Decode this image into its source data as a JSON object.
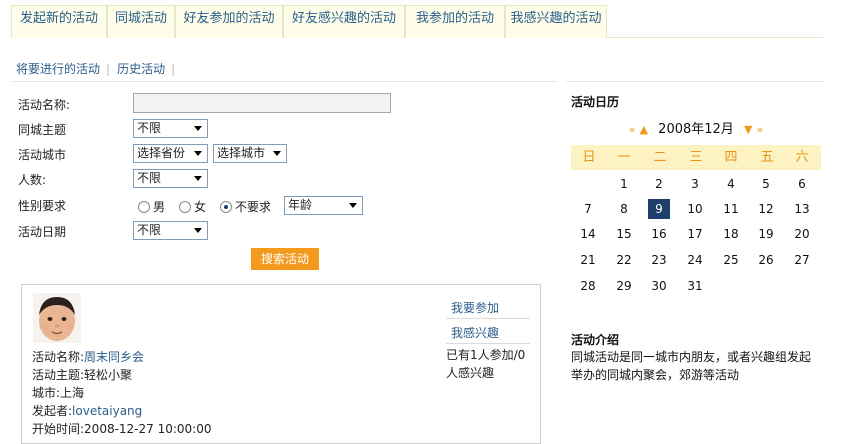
{
  "tabs": [
    {
      "label": "发起新的活动"
    },
    {
      "label": "同城活动"
    },
    {
      "label": "好友参加的活动"
    },
    {
      "label": "好友感兴趣的活动"
    },
    {
      "label": "我参加的活动"
    },
    {
      "label": "我感兴趣的活动"
    }
  ],
  "sublinks": {
    "upcoming": "将要进行的活动",
    "history": "历史活动",
    "separator": "|"
  },
  "form": {
    "name_label": "活动名称:",
    "name_value": "",
    "theme_label": "同城主题",
    "theme_value": "不限",
    "city_label": "活动城市",
    "province_value": "选择省份",
    "city_value": "选择城市",
    "people_label": "人数:",
    "people_value": "不限",
    "gender_label": "性别要求",
    "gender_options": {
      "male": "男",
      "female": "女",
      "none": "不要求"
    },
    "gender_selected": "none",
    "age_value": "年龄",
    "date_label": "活动日期",
    "date_value": "不限",
    "search_label": "搜索活动"
  },
  "activity": {
    "name_label": "活动名称:",
    "name_value": "周末同乡会",
    "theme_label": "活动主题:",
    "theme_value": "轻松小聚",
    "city_label": "城市:",
    "city_value": "上海",
    "organizer_label": "发起者:",
    "organizer_value": "lovetaiyang",
    "start_label": "开始时间:",
    "start_value": "2008-12-27 10:00:00",
    "join_label": "我要参加",
    "interest_label": "我感兴趣",
    "stats_text": "已有1人参加/0人感兴趣"
  },
  "calendar": {
    "title": "活动日历",
    "prev_year": "«",
    "prev_month": "▲",
    "month_label": "2008年12月",
    "next_month": "▼",
    "next_year": "»",
    "weekdays": [
      "日",
      "一",
      "二",
      "三",
      "四",
      "五",
      "六"
    ],
    "weeks": [
      [
        "",
        "1",
        "2",
        "3",
        "4",
        "5",
        "6"
      ],
      [
        "7",
        "8",
        "9",
        "10",
        "11",
        "12",
        "13"
      ],
      [
        "14",
        "15",
        "16",
        "17",
        "18",
        "19",
        "20"
      ],
      [
        "21",
        "22",
        "23",
        "24",
        "25",
        "26",
        "27"
      ],
      [
        "28",
        "29",
        "30",
        "31",
        "",
        "",
        ""
      ]
    ],
    "today": "9",
    "accent_color": "#f39a1e",
    "highlight_color": "#1e3e6c"
  },
  "intro": {
    "title": "活动介绍",
    "text": "同城活动是同一城市内朋友，或者兴趣组发起举办的同城内聚会，郊游等活动"
  }
}
